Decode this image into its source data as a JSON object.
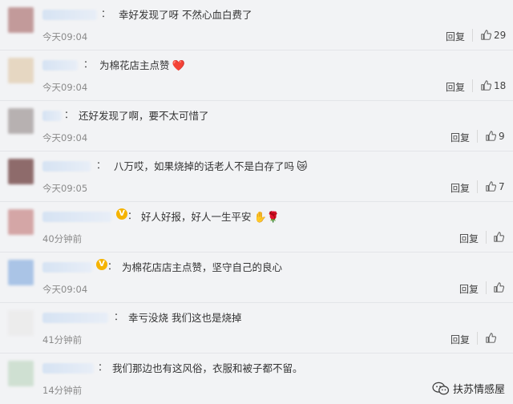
{
  "comments": [
    {
      "text": "幸好发现了呀 不然心血白费了",
      "emoji": "",
      "time": "今天09:04",
      "reply": "回复",
      "likes": "29",
      "verified": false,
      "avatar_color": "#b88f8f"
    },
    {
      "text": "为棉花店主点赞",
      "emoji": "❤️",
      "time": "今天09:04",
      "reply": "回复",
      "likes": "18",
      "verified": false,
      "avatar_color": "#e6d7c2"
    },
    {
      "text": "还好发现了啊，要不太可惜了",
      "emoji": "",
      "time": "今天09:04",
      "reply": "回复",
      "likes": "9",
      "verified": false,
      "avatar_color": "#b7b1b1"
    },
    {
      "text": "八万哎，如果烧掉的话老人不是白存了吗",
      "emoji": "😿",
      "time": "今天09:05",
      "reply": "回复",
      "likes": "7",
      "verified": false,
      "avatar_color": "#8e6b6b"
    },
    {
      "text": "好人好报，好人一生平安",
      "emoji": "✋🌹",
      "time": "40分钟前",
      "reply": "回复",
      "likes": "",
      "verified": true,
      "avatar_color": "#d4a6a6"
    },
    {
      "text": "为棉花店店主点赞，坚守自己的良心",
      "emoji": "",
      "time": "今天09:04",
      "reply": "回复",
      "likes": "",
      "verified": true,
      "avatar_color": "#aac4e6"
    },
    {
      "text": "幸亏没烧 我们这也是烧掉",
      "emoji": "",
      "time": "41分钟前",
      "reply": "回复",
      "likes": "",
      "verified": false,
      "avatar_color": "#e9e9e9"
    },
    {
      "text": "我们那边也有这风俗，衣服和被子都不留。",
      "emoji": "",
      "time": "14分钟前",
      "reply": "",
      "likes": "",
      "verified": false,
      "avatar_color": "#cfe0d2"
    }
  ],
  "watermark": {
    "text": "扶苏情感屋",
    "icon": "wechat-icon"
  }
}
